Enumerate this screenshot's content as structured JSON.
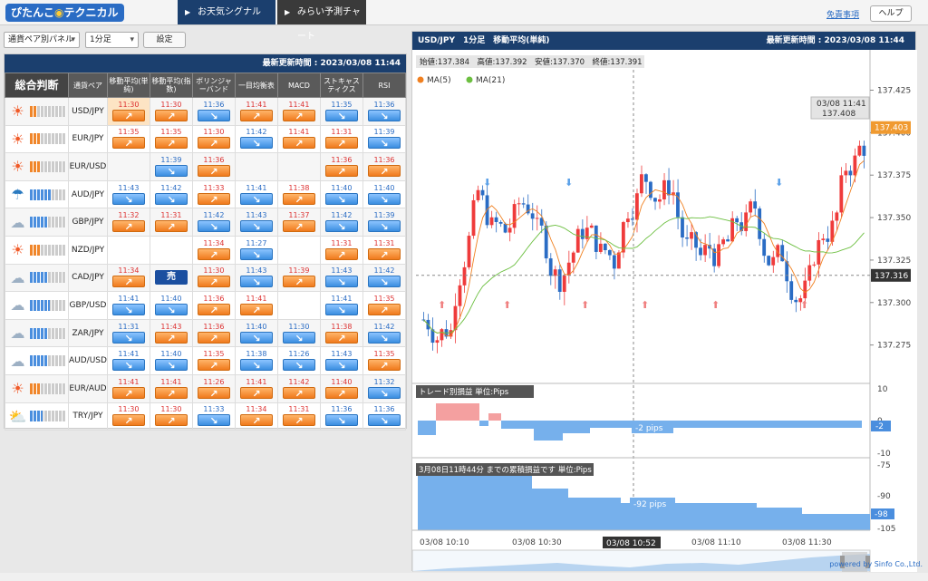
{
  "logo": {
    "text": "ぴたんこ",
    "icon": "sun-icon",
    "text2": "テクニカル"
  },
  "nav": {
    "tab1": "お天気シグナル",
    "tab2": "みらい予測チャート"
  },
  "header": {
    "disclaimer": "免責事項",
    "help": "ヘルプ"
  },
  "controls": {
    "panel_select": "通貨ペア別パネル",
    "timeframe_select": "1分足",
    "setting_button": "設定"
  },
  "left": {
    "updated": "最新更新時間 : 2023/03/08 11:44",
    "headers": [
      "総合判断",
      "通貨ペア",
      "移動平均(単純)",
      "移動平均(指数)",
      "ボリンジャーバンド",
      "一目均衡表",
      "MACD",
      "ストキャスティクス",
      "RSI"
    ],
    "rows": [
      {
        "pair": "USD/JPY",
        "weather": "sunny",
        "level": 0.2,
        "signals": [
          [
            "11:30",
            "up"
          ],
          [
            "11:30",
            "up"
          ],
          [
            "11:36",
            "down"
          ],
          [
            "11:41",
            "up"
          ],
          [
            "11:41",
            "up"
          ],
          [
            "11:35",
            "down"
          ],
          [
            "11:36",
            "down"
          ]
        ]
      },
      {
        "pair": "EUR/JPY",
        "weather": "sunny",
        "level": 0.3,
        "signals": [
          [
            "11:35",
            "up"
          ],
          [
            "11:35",
            "up"
          ],
          [
            "11:30",
            "up"
          ],
          [
            "11:42",
            "down"
          ],
          [
            "11:41",
            "up"
          ],
          [
            "11:31",
            "up"
          ],
          [
            "11:39",
            "down"
          ]
        ]
      },
      {
        "pair": "EUR/USD",
        "weather": "sunny",
        "level": 0.3,
        "signals": [
          null,
          [
            "11:39",
            "down"
          ],
          [
            "11:36",
            "up"
          ],
          null,
          null,
          [
            "11:36",
            "up"
          ],
          [
            "11:36",
            "up"
          ]
        ]
      },
      {
        "pair": "AUD/JPY",
        "weather": "rainy",
        "level": 0.6,
        "signals": [
          [
            "11:43",
            "down"
          ],
          [
            "11:42",
            "down"
          ],
          [
            "11:33",
            "up"
          ],
          [
            "11:41",
            "down"
          ],
          [
            "11:38",
            "up"
          ],
          [
            "11:40",
            "down"
          ],
          [
            "11:40",
            "down"
          ]
        ]
      },
      {
        "pair": "GBP/JPY",
        "weather": "cloudy",
        "level": 0.5,
        "signals": [
          [
            "11:32",
            "up"
          ],
          [
            "11:31",
            "up"
          ],
          [
            "11:42",
            "down"
          ],
          [
            "11:43",
            "down"
          ],
          [
            "11:37",
            "up"
          ],
          [
            "11:42",
            "down"
          ],
          [
            "11:39",
            "down"
          ]
        ]
      },
      {
        "pair": "NZD/JPY",
        "weather": "sunny",
        "level": 0.3,
        "signals": [
          null,
          null,
          [
            "11:34",
            "up"
          ],
          [
            "11:27",
            "down"
          ],
          null,
          [
            "11:31",
            "up"
          ],
          [
            "11:31",
            "up"
          ]
        ]
      },
      {
        "pair": "CAD/JPY",
        "weather": "cloudy",
        "level": 0.5,
        "signals": [
          [
            "11:34",
            "up"
          ],
          [
            "売",
            "sell"
          ],
          [
            "11:30",
            "up"
          ],
          [
            "11:43",
            "down"
          ],
          [
            "11:39",
            "up"
          ],
          [
            "11:43",
            "down"
          ],
          [
            "11:42",
            "down"
          ]
        ]
      },
      {
        "pair": "GBP/USD",
        "weather": "cloudy",
        "level": 0.55,
        "signals": [
          [
            "11:41",
            "down"
          ],
          [
            "11:40",
            "down"
          ],
          [
            "11:36",
            "up"
          ],
          [
            "11:41",
            "up"
          ],
          null,
          [
            "11:41",
            "down"
          ],
          [
            "11:35",
            "up"
          ]
        ]
      },
      {
        "pair": "ZAR/JPY",
        "weather": "cloudy",
        "level": 0.5,
        "signals": [
          [
            "11:31",
            "down"
          ],
          [
            "11:43",
            "up"
          ],
          [
            "11:36",
            "up"
          ],
          [
            "11:40",
            "down"
          ],
          [
            "11:30",
            "down"
          ],
          [
            "11:38",
            "up"
          ],
          [
            "11:42",
            "down"
          ]
        ]
      },
      {
        "pair": "AUD/USD",
        "weather": "cloudy",
        "level": 0.5,
        "signals": [
          [
            "11:41",
            "down"
          ],
          [
            "11:40",
            "down"
          ],
          [
            "11:35",
            "up"
          ],
          [
            "11:38",
            "down"
          ],
          [
            "11:26",
            "down"
          ],
          [
            "11:43",
            "down"
          ],
          [
            "11:35",
            "up"
          ]
        ]
      },
      {
        "pair": "EUR/AUD",
        "weather": "sunny",
        "level": 0.3,
        "signals": [
          [
            "11:41",
            "up"
          ],
          [
            "11:41",
            "up"
          ],
          [
            "11:26",
            "up"
          ],
          [
            "11:41",
            "up"
          ],
          [
            "11:42",
            "up"
          ],
          [
            "11:40",
            "up"
          ],
          [
            "11:32",
            "down"
          ]
        ]
      },
      {
        "pair": "TRY/JPY",
        "weather": "partly",
        "level": 0.35,
        "signals": [
          [
            "11:30",
            "up"
          ],
          [
            "11:30",
            "up"
          ],
          [
            "11:33",
            "down"
          ],
          [
            "11:34",
            "up"
          ],
          [
            "11:31",
            "up"
          ],
          [
            "11:36",
            "down"
          ],
          [
            "11:36",
            "down"
          ]
        ]
      }
    ]
  },
  "right": {
    "title": "USD/JPY　1分足　移動平均(単純)",
    "updated": "最新更新時間 : 2023/03/08 11:44",
    "ohlc": "始値:137.384　高値:137.392　安値:137.370　終値:137.391",
    "legend": [
      "MA(5)",
      "MA(21)"
    ],
    "tooltip_time": "03/08 11:41",
    "tooltip_value": "137.408",
    "current_price": "137.403",
    "cursor_price": "137.316",
    "sub1_title": "トレード別損益 単位:Pips",
    "sub1_label": "-2 pips",
    "sub1_axis_value": "-2",
    "sub2_title": "3月08日11時44分 までの累積損益です 単位:Pips",
    "sub2_label": "-92 pips",
    "sub2_axis_value": "-98",
    "cursor_time": "03/08 10:52",
    "powered": "powered by Sinfo Co.,Ltd."
  },
  "chart_data": {
    "type": "candlestick",
    "y_ticks": [
      "137.425",
      "137.400",
      "137.375",
      "137.350",
      "137.325",
      "137.300",
      "137.275"
    ],
    "ylim": [
      137.262,
      137.437
    ],
    "sub1_ticks": [
      "10",
      "0",
      "-10"
    ],
    "sub2_ticks": [
      "-75",
      "-90",
      "-105"
    ],
    "x_ticks": [
      "03/08 10:10",
      "03/08 10:30",
      "03/08 11:10",
      "03/08 11:30"
    ],
    "colors": {
      "up": "#ef3b3b",
      "down": "#2a6cc4",
      "ma5": "#f08020",
      "ma21": "#6cbf40"
    }
  }
}
